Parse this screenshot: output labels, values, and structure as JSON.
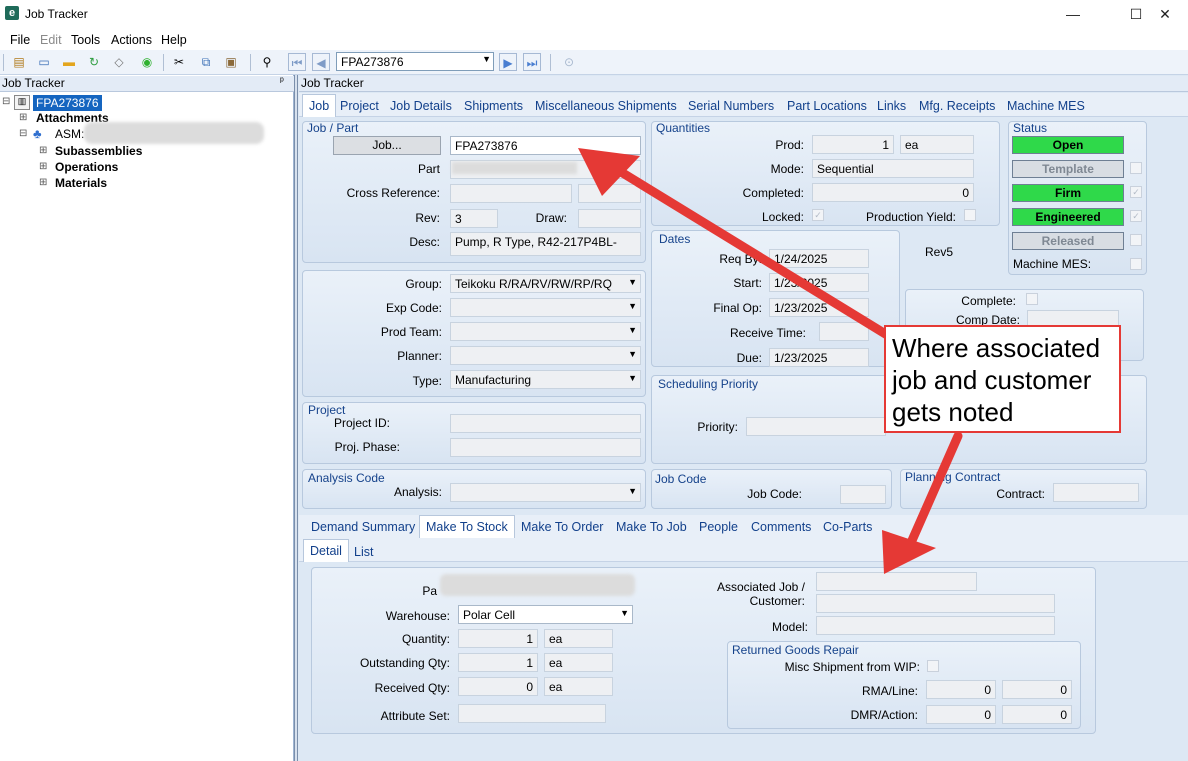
{
  "window": {
    "title": "Job Tracker",
    "minimize": "—",
    "maximize": "☐",
    "close": "✕"
  },
  "menu": [
    "File",
    "Edit",
    "Tools",
    "Actions",
    "Help"
  ],
  "toolbar": {
    "job_value": "FPA273876"
  },
  "left_panel": {
    "header": "Job Tracker",
    "pin": "📌",
    "root": "FPA273876",
    "items": [
      "Attachments",
      "ASM:",
      "Subassemblies",
      "Operations",
      "Materials"
    ]
  },
  "right_panel": {
    "header": "Job Tracker"
  },
  "tabs_top": [
    "Job",
    "Project",
    "Job Details",
    "Shipments",
    "Miscellaneous Shipments",
    "Serial Numbers",
    "Part Locations",
    "Links",
    "Mfg. Receipts",
    "Machine MES"
  ],
  "job_part": {
    "title": "Job / Part",
    "job_button": "Job...",
    "job_value": "FPA273876",
    "part_label": "Part",
    "part_value": "",
    "cross_ref_label": "Cross Reference:",
    "rev_label": "Rev:",
    "rev_value": "3",
    "draw_label": "Draw:",
    "desc_label": "Desc:",
    "desc_value": "Pump, R Type, R42-217P4BL-"
  },
  "quantities": {
    "title": "Quantities",
    "prod_label": "Prod:",
    "prod_value": "1",
    "prod_uom": "ea",
    "mode_label": "Mode:",
    "mode_value": "Sequential",
    "completed_label": "Completed:",
    "completed_value": "0",
    "locked_label": "Locked:",
    "yield_label": "Production Yield:"
  },
  "status": {
    "title": "Status",
    "open": "Open",
    "template": "Template",
    "firm": "Firm",
    "engineered": "Engineered",
    "released": "Released",
    "machine_mes": "Machine MES:"
  },
  "dates": {
    "title": "Dates",
    "req_by_label": "Req By:",
    "req_by_value": "1/24/2025",
    "start_label": "Start:",
    "start_value": "1/23/2025",
    "final_op_label": "Final Op:",
    "final_op_value": "1/23/2025",
    "receive_time_label": "Receive Time:",
    "due_label": "Due:",
    "due_value": "1/23/2025",
    "rev5": "Rev5"
  },
  "complete": {
    "complete_label": "Complete:",
    "comp_date_label": "Comp Date:"
  },
  "group_box": {
    "group_label": "Group:",
    "group_value": "Teikoku R/RA/RV/RW/RP/RQ",
    "exp_code_label": "Exp Code:",
    "prod_team_label": "Prod Team:",
    "planner_label": "Planner:",
    "type_label": "Type:",
    "type_value": "Manufacturing"
  },
  "scheduling": {
    "title": "Scheduling Priority",
    "priority_label": "Priority:"
  },
  "project": {
    "title": "Project",
    "id_label": "Project ID:",
    "phase_label": "Proj. Phase:"
  },
  "analysis": {
    "title": "Analysis Code",
    "label": "Analysis:"
  },
  "job_code": {
    "title": "Job Code",
    "label": "Job Code:"
  },
  "planning": {
    "title": "Planning Contract",
    "label": "Contract:"
  },
  "tabs_mid": [
    "Demand Summary",
    "Make To Stock",
    "Make To Order",
    "Make To Job",
    "People",
    "Comments",
    "Co-Parts"
  ],
  "tabs_sub": [
    "Detail",
    "List"
  ],
  "detail": {
    "part_label": "Pa",
    "warehouse_label": "Warehouse:",
    "warehouse_value": "Polar Cell",
    "quantity_label": "Quantity:",
    "quantity_value": "1",
    "quantity_uom": "ea",
    "outstanding_label": "Outstanding Qty:",
    "outstanding_value": "1",
    "outstanding_uom": "ea",
    "received_label": "Received Qty:",
    "received_value": "0",
    "received_uom": "ea",
    "attribute_label": "Attribute Set:",
    "assoc_label_1": "Associated Job /",
    "assoc_label_2": "Customer:",
    "model_label": "Model:",
    "rgr_title": "Returned Goods Repair",
    "misc_label": "Misc Shipment from WIP:",
    "rma_label": "RMA/Line:",
    "rma_1": "0",
    "rma_2": "0",
    "dmr_label": "DMR/Action:",
    "dmr_1": "0",
    "dmr_2": "0"
  },
  "callout": "Where associated job and customer gets noted",
  "colors": {
    "annotation": "#e53935",
    "status_green": "#2fd94a",
    "tab_text": "#12408b"
  }
}
